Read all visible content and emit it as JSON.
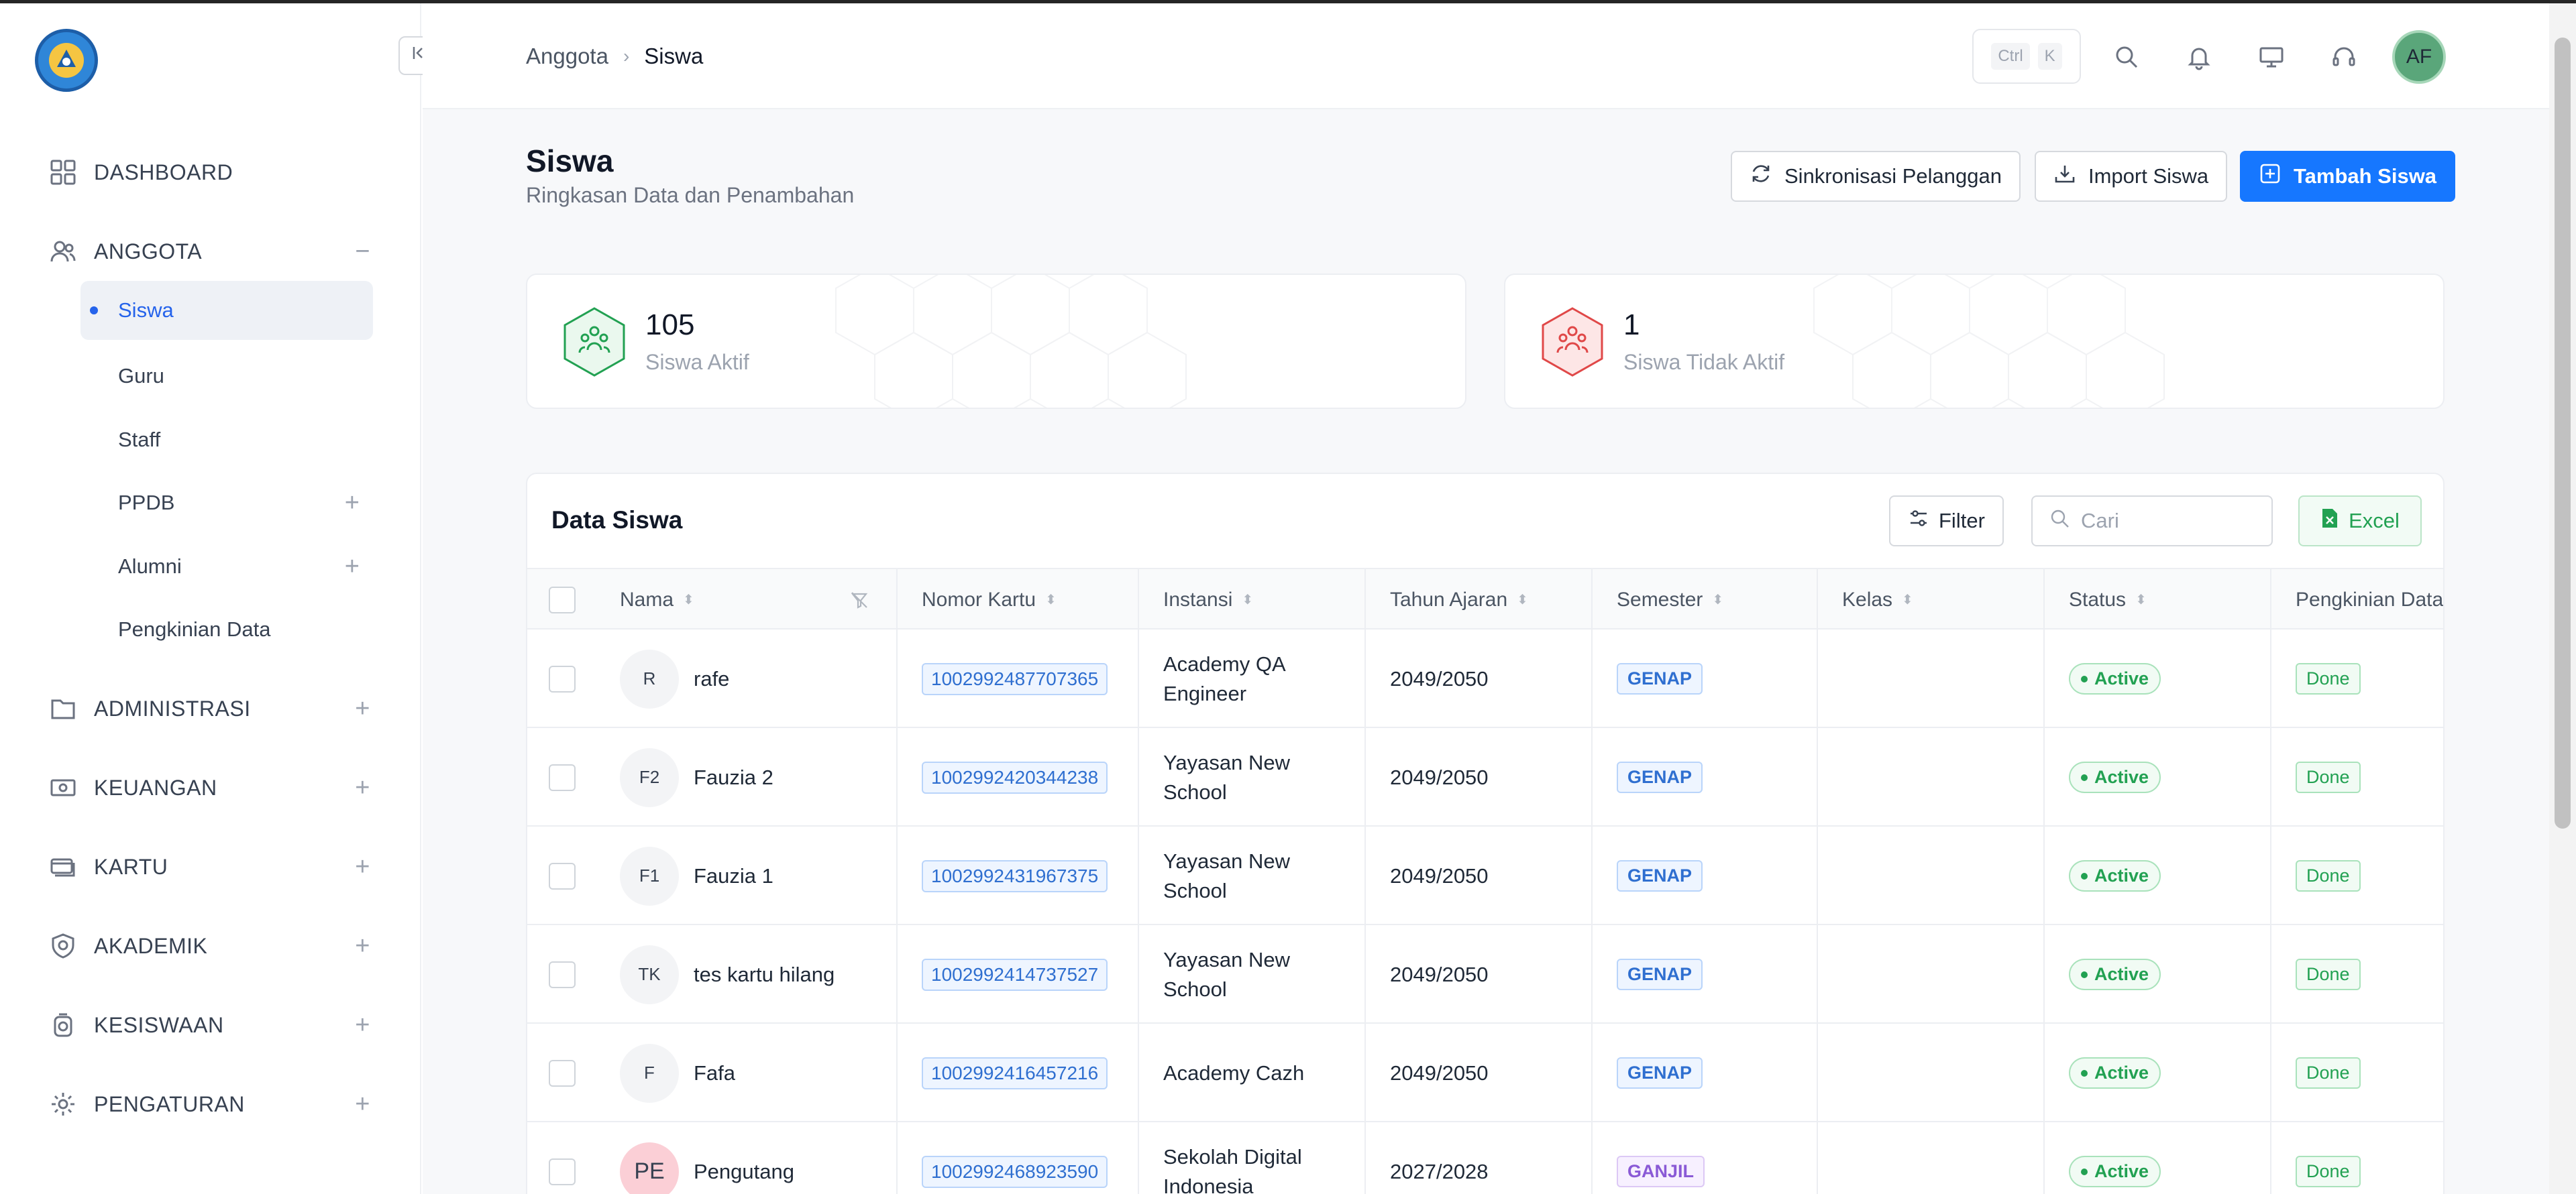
{
  "sidebar": {
    "items": [
      {
        "label": "DASHBOARD"
      },
      {
        "label": "ANGGOTA",
        "expander": "−"
      },
      {
        "label": "ADMINISTRASI",
        "expander": "+"
      },
      {
        "label": "KEUANGAN",
        "expander": "+"
      },
      {
        "label": "KARTU",
        "expander": "+"
      },
      {
        "label": "AKADEMIK",
        "expander": "+"
      },
      {
        "label": "KESISWAAN",
        "expander": "+"
      },
      {
        "label": "PENGATURAN",
        "expander": "+"
      }
    ],
    "sub_items": [
      {
        "label": "Siswa",
        "active": true
      },
      {
        "label": "Guru"
      },
      {
        "label": "Staff"
      },
      {
        "label": "PPDB",
        "expander": "+"
      },
      {
        "label": "Alumni",
        "expander": "+"
      },
      {
        "label": "Pengkinian Data"
      }
    ]
  },
  "header": {
    "breadcrumb": {
      "parent": "Anggota",
      "separator": "›",
      "current": "Siswa"
    },
    "shortcut": {
      "key1": "Ctrl",
      "key2": "K"
    },
    "avatar_initials": "AF"
  },
  "page": {
    "title": "Siswa",
    "subtitle": "Ringkasan Data dan Penambahan",
    "buttons": {
      "sync": "Sinkronisasi Pelanggan",
      "import": "Import Siswa",
      "add": "Tambah Siswa"
    }
  },
  "stats": {
    "active": {
      "value": "105",
      "label": "Siswa Aktif",
      "color": "#22a152"
    },
    "inactive": {
      "value": "1",
      "label": "Siswa Tidak Aktif",
      "color": "#e04848"
    }
  },
  "table": {
    "title": "Data Siswa",
    "filter_label": "Filter",
    "search_placeholder": "Cari",
    "excel_label": "Excel",
    "columns": [
      "Nama",
      "Nomor Kartu",
      "Instansi",
      "Tahun Ajaran",
      "Semester",
      "Kelas",
      "Status",
      "Pengkinian Data"
    ],
    "rows": [
      {
        "initials": "R",
        "name": "rafe",
        "card": "1002992487707365",
        "instansi_1": "Academy QA",
        "instansi_2": "Engineer",
        "tahun": "2049/2050",
        "semester": "GENAP",
        "kelas": "",
        "status": "Active",
        "update": "Done"
      },
      {
        "initials": "F2",
        "name": "Fauzia 2",
        "card": "1002992420344238",
        "instansi_1": "Yayasan New",
        "instansi_2": "School",
        "tahun": "2049/2050",
        "semester": "GENAP",
        "kelas": "",
        "status": "Active",
        "update": "Done"
      },
      {
        "initials": "F1",
        "name": "Fauzia 1",
        "card": "1002992431967375",
        "instansi_1": "Yayasan New",
        "instansi_2": "School",
        "tahun": "2049/2050",
        "semester": "GENAP",
        "kelas": "",
        "status": "Active",
        "update": "Done"
      },
      {
        "initials": "TK",
        "name": "tes kartu hilang",
        "card": "1002992414737527",
        "instansi_1": "Yayasan New",
        "instansi_2": "School",
        "tahun": "2049/2050",
        "semester": "GENAP",
        "kelas": "",
        "status": "Active",
        "update": "Done"
      },
      {
        "initials": "F",
        "name": "Fafa",
        "card": "1002992416457216",
        "instansi_1": "Academy Cazh",
        "instansi_2": "",
        "tahun": "2049/2050",
        "semester": "GENAP",
        "kelas": "",
        "status": "Active",
        "update": "Done"
      },
      {
        "initials": "PE",
        "name": "Pengutang",
        "card": "1002992468923590",
        "instansi_1": "Sekolah Digital",
        "instansi_2": "Indonesia",
        "tahun": "2027/2028",
        "semester": "GANJIL",
        "kelas": "",
        "status": "Active",
        "update": "Done"
      }
    ]
  },
  "colors": {
    "accent": "#1677ff",
    "success": "#22a152",
    "danger": "#e04848"
  }
}
